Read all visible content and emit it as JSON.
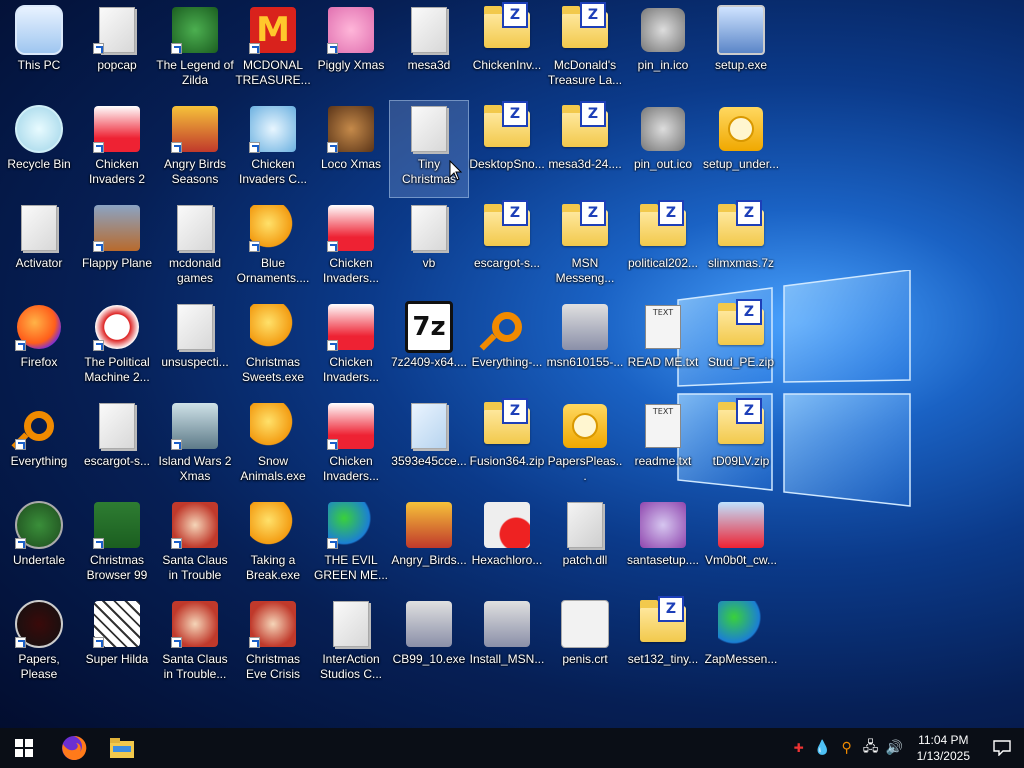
{
  "desktop": {
    "icons": [
      {
        "label": "This PC",
        "kind": "pc",
        "shortcut": false
      },
      {
        "label": "popcap",
        "kind": "file",
        "shortcut": true
      },
      {
        "label": "The Legend of Zilda",
        "kind": "game-green",
        "shortcut": true
      },
      {
        "label": "MCDONAL TREASURE...",
        "kind": "mcd",
        "shortcut": true
      },
      {
        "label": "Piggly Xmas",
        "kind": "pig",
        "shortcut": true
      },
      {
        "label": "mesa3d",
        "kind": "file",
        "shortcut": false
      },
      {
        "label": "ChickenInv...",
        "kind": "zip",
        "shortcut": false
      },
      {
        "label": "McDonald's Treasure La...",
        "kind": "zip",
        "shortcut": false
      },
      {
        "label": "pin_in.ico",
        "kind": "ico",
        "shortcut": false
      },
      {
        "label": "setup.exe",
        "kind": "setup",
        "shortcut": false
      },
      {
        "label": "Recycle Bin",
        "kind": "bin",
        "shortcut": false
      },
      {
        "label": "Chicken Invaders 2",
        "kind": "chicken",
        "shortcut": true
      },
      {
        "label": "Angry Birds Seasons",
        "kind": "angry",
        "shortcut": true
      },
      {
        "label": "Chicken Invaders C...",
        "kind": "snowman",
        "shortcut": true
      },
      {
        "label": "Loco Xmas",
        "kind": "bear",
        "shortcut": true
      },
      {
        "label": "Tiny Christmas",
        "kind": "file",
        "shortcut": false,
        "selected": true
      },
      {
        "label": "DesktopSno...",
        "kind": "zip",
        "shortcut": false
      },
      {
        "label": "mesa3d-24....",
        "kind": "zip",
        "shortcut": false
      },
      {
        "label": "pin_out.ico",
        "kind": "ico",
        "shortcut": false
      },
      {
        "label": "setup_under...",
        "kind": "disc",
        "shortcut": false
      },
      {
        "label": "Activator",
        "kind": "file",
        "shortcut": false
      },
      {
        "label": "Flappy Plane",
        "kind": "photo",
        "shortcut": true
      },
      {
        "label": "mcdonald games",
        "kind": "file",
        "shortcut": false
      },
      {
        "label": "Blue Ornaments....",
        "kind": "puzzle",
        "shortcut": true
      },
      {
        "label": "Chicken Invaders...",
        "kind": "chicken2",
        "shortcut": true
      },
      {
        "label": "vb",
        "kind": "file",
        "shortcut": false
      },
      {
        "label": "escargot-s...",
        "kind": "zip",
        "shortcut": false
      },
      {
        "label": "MSN Messeng...",
        "kind": "zip",
        "shortcut": false
      },
      {
        "label": "political202...",
        "kind": "zip",
        "shortcut": false
      },
      {
        "label": "slimxmas.7z",
        "kind": "zip",
        "shortcut": false
      },
      {
        "label": "Firefox",
        "kind": "firefox",
        "shortcut": true
      },
      {
        "label": "The Political Machine 2...",
        "kind": "political",
        "shortcut": true
      },
      {
        "label": "unsuspecti...",
        "kind": "file",
        "shortcut": false
      },
      {
        "label": "Christmas Sweets.exe",
        "kind": "puzzle",
        "shortcut": false
      },
      {
        "label": "Chicken Invaders...",
        "kind": "space",
        "shortcut": true
      },
      {
        "label": "7z2409-x64....",
        "kind": "sevenzip",
        "shortcut": false
      },
      {
        "label": "Everything-...",
        "kind": "search",
        "shortcut": false
      },
      {
        "label": "msn610155-...",
        "kind": "installer",
        "shortcut": false
      },
      {
        "label": "READ ME.txt",
        "kind": "txt",
        "shortcut": false
      },
      {
        "label": "Stud_PE.zip",
        "kind": "zip",
        "shortcut": false
      },
      {
        "label": "Everything",
        "kind": "search",
        "shortcut": true
      },
      {
        "label": "escargot-s...",
        "kind": "file",
        "shortcut": false
      },
      {
        "label": "Island Wars 2 Xmas",
        "kind": "island",
        "shortcut": true
      },
      {
        "label": "Snow Animals.exe",
        "kind": "puzzle",
        "shortcut": false
      },
      {
        "label": "Chicken Invaders...",
        "kind": "chicken3",
        "shortcut": true
      },
      {
        "label": "3593e45cce...",
        "kind": "pdf",
        "shortcut": false
      },
      {
        "label": "Fusion364.zip",
        "kind": "zip",
        "shortcut": false
      },
      {
        "label": "PapersPleas...",
        "kind": "disc",
        "shortcut": false
      },
      {
        "label": "readme.txt",
        "kind": "txt",
        "shortcut": false
      },
      {
        "label": "tD09LV.zip",
        "kind": "zip",
        "shortcut": false
      },
      {
        "label": "Undertale",
        "kind": "undertale",
        "shortcut": true
      },
      {
        "label": "Christmas Browser 99",
        "kind": "tree",
        "shortcut": true
      },
      {
        "label": "Santa Claus in Trouble",
        "kind": "santa",
        "shortcut": true
      },
      {
        "label": "Taking a Break.exe",
        "kind": "puzzle",
        "shortcut": false
      },
      {
        "label": "THE EVIL GREEN ME...",
        "kind": "msn",
        "shortcut": true
      },
      {
        "label": "Angry_Birds...",
        "kind": "angry",
        "shortcut": false
      },
      {
        "label": "Hexachloro...",
        "kind": "hex",
        "shortcut": false
      },
      {
        "label": "patch.dll",
        "kind": "dll",
        "shortcut": false
      },
      {
        "label": "santasetup....",
        "kind": "santa2",
        "shortcut": false
      },
      {
        "label": "Vm0b0t_cw...",
        "kind": "santa3",
        "shortcut": false
      },
      {
        "label": "Papers, Please",
        "kind": "papers",
        "shortcut": true
      },
      {
        "label": "Super Hilda",
        "kind": "hilda",
        "shortcut": true
      },
      {
        "label": "Santa Claus in Trouble... A...",
        "kind": "santa",
        "shortcut": true
      },
      {
        "label": "Christmas Eve Crisis",
        "kind": "santa4",
        "shortcut": true
      },
      {
        "label": "InterAction Studios C...",
        "kind": "file",
        "shortcut": false
      },
      {
        "label": "CB99_10.exe",
        "kind": "installer",
        "shortcut": false
      },
      {
        "label": "Install_MSN...",
        "kind": "installer",
        "shortcut": false
      },
      {
        "label": "penis.crt",
        "kind": "cert",
        "shortcut": false
      },
      {
        "label": "set132_tiny...",
        "kind": "zip",
        "shortcut": false
      },
      {
        "label": "ZapMessen...",
        "kind": "msn",
        "shortcut": false
      }
    ]
  },
  "taskbar": {
    "start_icon": "windows-logo-icon",
    "pinned": [
      "firefox-icon",
      "file-explorer-icon"
    ],
    "tray_icons": [
      "tray-app-icon",
      "drop-icon",
      "search-tray-icon",
      "network-icon",
      "volume-icon"
    ],
    "time": "11:04 PM",
    "date": "1/13/2025",
    "notification_icon": "action-center-icon"
  },
  "colors": {
    "taskbar": "#0a0e16",
    "zip_blue": "#1d3fb8",
    "folder_yellow": "#f2c94c"
  }
}
